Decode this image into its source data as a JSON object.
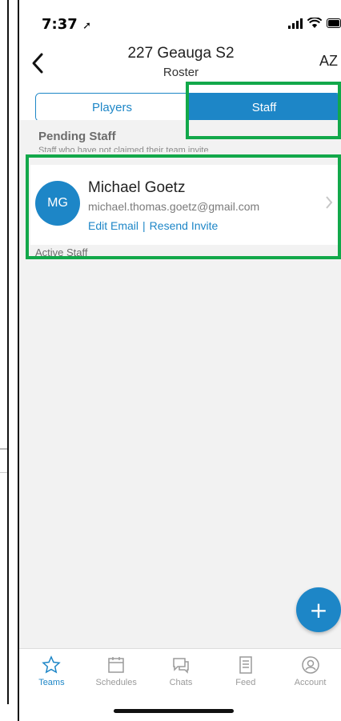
{
  "status_bar": {
    "time": "7:37"
  },
  "nav": {
    "title": "227 Geauga S2",
    "subtitle": "Roster",
    "sort_label": "AZ"
  },
  "segment": {
    "players_label": "Players",
    "staff_label": "Staff"
  },
  "pending": {
    "header": "Pending Staff",
    "subheader": "Staff who have not claimed their team invite",
    "items": [
      {
        "initials": "MG",
        "name": "Michael Goetz",
        "email": "michael.thomas.goetz@gmail.com",
        "edit_email_label": "Edit Email",
        "resend_label": "Resend Invite"
      }
    ]
  },
  "active": {
    "header": "Active Staff"
  },
  "fab": {
    "label": "+"
  },
  "tabs": [
    {
      "label": "Teams",
      "icon": "star-icon",
      "active": true
    },
    {
      "label": "Schedules",
      "icon": "calendar-icon",
      "active": false
    },
    {
      "label": "Chats",
      "icon": "chat-icon",
      "active": false
    },
    {
      "label": "Feed",
      "icon": "feed-icon",
      "active": false
    },
    {
      "label": "Account",
      "icon": "account-icon",
      "active": false
    }
  ],
  "colors": {
    "accent": "#1d86c7",
    "highlight": "#12a84a",
    "background": "#f2f2f2"
  }
}
